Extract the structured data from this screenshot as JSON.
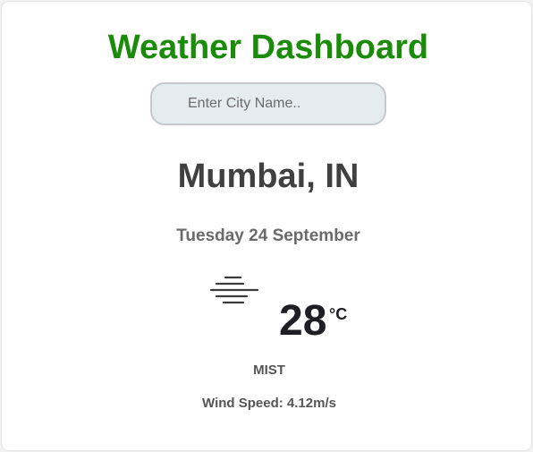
{
  "header": {
    "title": "Weather Dashboard"
  },
  "search": {
    "placeholder": "Enter City Name.."
  },
  "weather": {
    "location": "Mumbai, IN",
    "date": "Tuesday 24 September",
    "icon": "mist-icon",
    "temperature": "28",
    "unit": "°C",
    "description": "MIST",
    "wind": "Wind Speed: 4.12m/s"
  },
  "colors": {
    "title": "#1a8c0a",
    "city": "#404040",
    "secondary_text": "#555555",
    "search_bg": "#e5ecef"
  }
}
